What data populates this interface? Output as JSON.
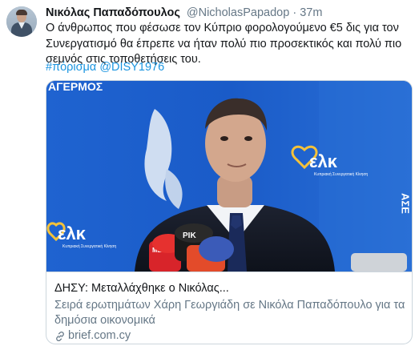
{
  "tweet": {
    "display_name": "Νικόλας Παπαδόπουλος",
    "handle": "@NicholasPapadop",
    "separator": "·",
    "time": "37m",
    "text_lines": [
      "Ο άνθρωπος που φέσωσε τον Κύπριο φορολογούμενο €5 δις για τον",
      "Συνεργατισμό θα έπρεπε να ήταν πολύ πιο προσεκτικός και πολύ πιο",
      "σεμνός στις τοποθετήσεις του."
    ],
    "hashtag": "#πόρισμα",
    "mention": "@DISY1976",
    "avatar_icon": "profile-photo"
  },
  "card": {
    "image_signs": {
      "top_left": "ΑΓΕΡΜΟΣ",
      "logo_right": "ελκ",
      "logo_right_sub": "Κυπριακή Συνεργατική Κίνηση",
      "logo_left": "ελκ",
      "logo_left_sub": "Κυπριακή Συνεργατική Κίνηση",
      "side_letters": "ΑΣΕ",
      "mic_1": "ΡΙΚ",
      "mic_2": "MEGA"
    },
    "title": "ΔΗΣΥ: Μεταλλάχθηκε ο Νικόλας...",
    "description": "Σειρά ερωτημάτων Χάρη Γεωργιάδη σε Νικόλα Παπαδόπουλο για τα δημόσια οικονομικά",
    "domain": "brief.com.cy",
    "link_icon": "link-icon"
  },
  "colors": {
    "link": "#1b95e0",
    "secondary_text": "#657786",
    "banner_blue": "#1756c4"
  }
}
